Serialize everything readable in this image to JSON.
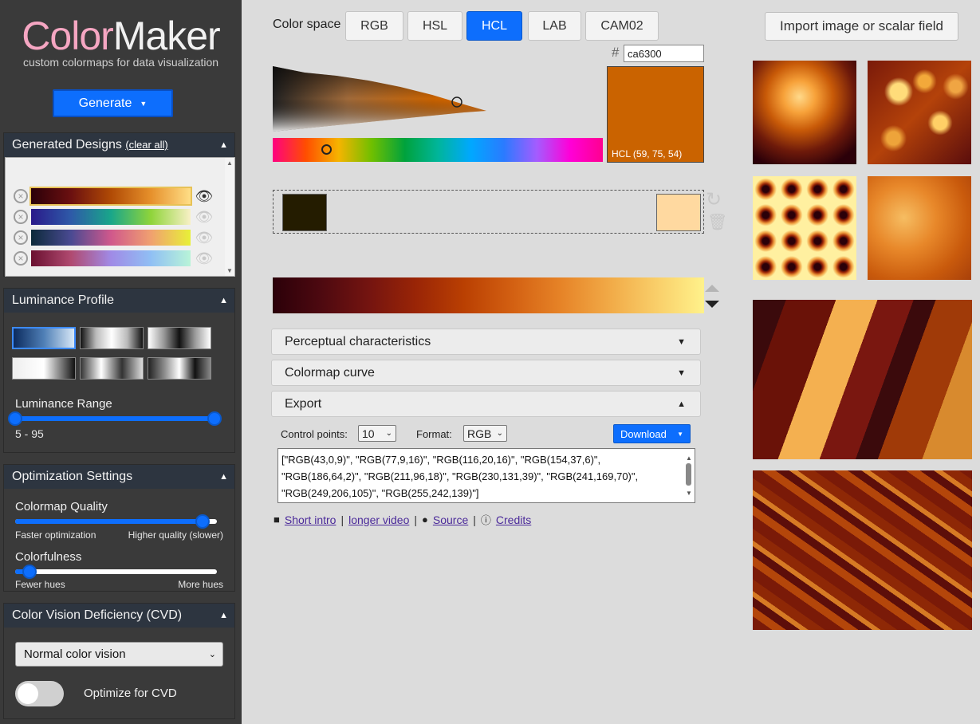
{
  "app": {
    "logo_part1": "Color",
    "logo_part2": "Maker",
    "tagline": "custom colormaps for data visualization",
    "generate_label": "Generate"
  },
  "generated_designs": {
    "title": "Generated Designs",
    "clear_all": "(clear all)",
    "items": [
      {
        "gradient": [
          "#2b0009",
          "#6b1010",
          "#b04a05",
          "#e6902b",
          "#ffde86"
        ],
        "visible": true
      },
      {
        "gradient": [
          "#2a1a8a",
          "#2e5aa8",
          "#19a68a",
          "#8fd43a",
          "#f8f0c6"
        ],
        "visible": false
      },
      {
        "gradient": [
          "#0c2a3a",
          "#4a4a92",
          "#d0588c",
          "#f0a070",
          "#e8f038"
        ],
        "visible": false
      },
      {
        "gradient": [
          "#6a1030",
          "#b04a70",
          "#a08ae6",
          "#90bff4",
          "#b8f4d8"
        ],
        "visible": false
      }
    ]
  },
  "luminance_profile": {
    "title": "Luminance Profile",
    "range_label": "Luminance Range",
    "range_value": "5 - 95",
    "range_min": 5,
    "range_max": 95
  },
  "optimization": {
    "title": "Optimization Settings",
    "quality_label": "Colormap Quality",
    "quality_low": "Faster optimization",
    "quality_high": "Higher quality (slower)",
    "quality_value": 0.93,
    "colorfulness_label": "Colorfulness",
    "colorfulness_low": "Fewer hues",
    "colorfulness_high": "More hues",
    "colorfulness_value": 0.07
  },
  "cvd": {
    "title": "Color Vision Deficiency (CVD)",
    "selected": "Normal color vision",
    "toggle_label": "Optimize for CVD",
    "toggle_on": false
  },
  "color_space": {
    "label": "Color space",
    "options": [
      "RGB",
      "HSL",
      "HCL",
      "LAB",
      "CAM02"
    ],
    "active": "HCL"
  },
  "picker": {
    "hash": "#",
    "hex_value": "ca6300",
    "swatch_color": "#ca6300",
    "swatch_label": "HCL (59, 75, 54)"
  },
  "stops": {
    "left_color": "#241c00",
    "right_color": "#ffd9a0"
  },
  "icons": {
    "refresh": "refresh-icon",
    "trash": "trash-icon",
    "eye": "eye-icon",
    "video": "video-icon",
    "github": "github-icon",
    "info": "info-icon"
  },
  "accordions": {
    "perceptual": "Perceptual characteristics",
    "curve": "Colormap curve",
    "export": "Export"
  },
  "export": {
    "control_points_label": "Control points:",
    "control_points_value": "10",
    "format_label": "Format:",
    "format_value": "RGB",
    "download_label": "Download",
    "output_lines": [
      "[\"RGB(43,0,9)\", \"RGB(77,9,16)\", \"RGB(116,20,16)\", \"RGB(154,37,6)\",",
      "\"RGB(186,64,2)\", \"RGB(211,96,18)\", \"RGB(230,131,39)\", \"RGB(241,169,70)\",",
      "\"RGB(249,206,105)\", \"RGB(255,242,139)\"]"
    ]
  },
  "links": {
    "intro": "Short intro",
    "video": "longer video",
    "source": "Source",
    "credits": "Credits",
    "separator": "|"
  },
  "right_panel": {
    "import_label": "Import image or scalar field"
  }
}
